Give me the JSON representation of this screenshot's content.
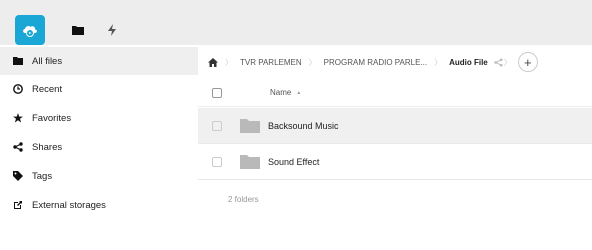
{
  "topbar": {
    "icons": [
      "cloud-logo",
      "files-icon",
      "activity-icon"
    ]
  },
  "sidebar": {
    "items": [
      {
        "label": "All files",
        "icon": "folder-icon"
      },
      {
        "label": "Recent",
        "icon": "clock-icon"
      },
      {
        "label": "Favorites",
        "icon": "star-icon"
      },
      {
        "label": "Shares",
        "icon": "share-icon"
      },
      {
        "label": "Tags",
        "icon": "tag-icon"
      },
      {
        "label": "External storages",
        "icon": "external-icon"
      }
    ]
  },
  "breadcrumb": {
    "items": [
      "TVR PARLEMEN",
      "PROGRAM RADIO PARLE...",
      "Audio File"
    ],
    "add_label": "+"
  },
  "table": {
    "name_header": "Name",
    "sort_indicator": "▲",
    "rows": [
      {
        "name": "Backsound Music"
      },
      {
        "name": "Sound Effect"
      }
    ],
    "summary": "2 folders"
  },
  "colors": {
    "accent": "#1ba7d6",
    "folder": "#b9b9b9"
  }
}
